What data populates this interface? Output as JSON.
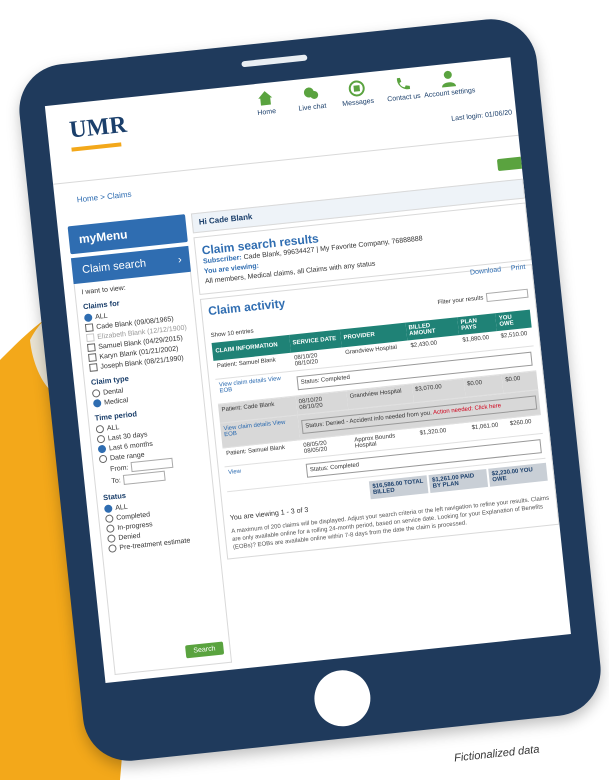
{
  "colors": {
    "brand_navy": "#1f3a5c",
    "hand_orange": "#f3a81a",
    "table_teal": "#1f8276",
    "action_green": "#5aa33f",
    "menu_blue": "#2f6db1"
  },
  "header": {
    "logo": "UMR",
    "nav": [
      {
        "label": "Home",
        "icon": "home-icon"
      },
      {
        "label": "Live chat",
        "icon": "chat-icon"
      },
      {
        "label": "Messages",
        "icon": "messages-icon"
      },
      {
        "label": "Contact us",
        "icon": "phone-icon"
      },
      {
        "label": "Account settings",
        "icon": "person-icon"
      }
    ],
    "last_login": "Last login: 01/06/20"
  },
  "breadcrumb": "Home > Claims",
  "sidebar": {
    "mymenu": "myMenu",
    "claim_search": "Claim search",
    "intro": "I want to view:",
    "claims_for": {
      "heading": "Claims for",
      "options": [
        "ALL",
        "Cade Blank (09/08/1965)",
        "Elizabeth Blank (12/12/1900)",
        "Samuel Blank (04/29/2015)",
        "Karyn Blank (01/21/2002)",
        "Joseph Blank (08/21/1990)"
      ]
    },
    "claim_type": {
      "heading": "Claim type",
      "options": [
        "Dental",
        "Medical"
      ]
    },
    "time_period": {
      "heading": "Time period",
      "options": [
        "ALL",
        "Last 30 days",
        "Last 6 months",
        "Date range"
      ],
      "from": "From:",
      "to": "To:"
    },
    "status": {
      "heading": "Status",
      "options": [
        "ALL",
        "Completed",
        "In-progress",
        "Denied",
        "Pre-treatment estimate"
      ]
    },
    "search_button": "Search"
  },
  "main": {
    "greeting": "Hi Cade Blank",
    "results": {
      "title": "Claim search results",
      "subscriber_label": "Subscriber:",
      "subscriber": "Cade Blank, 99634427 | My Favorite Company, 76888888",
      "viewing_label": "You are viewing:",
      "viewing": "All members, Medical claims, all Claims with any status"
    },
    "activity": {
      "title": "Claim activity",
      "download": "Download",
      "print": "Print",
      "filter": "Filter your results",
      "show": "Show 10 entries",
      "columns": [
        "CLAIM INFORMATION",
        "SERVICE DATE",
        "PROVIDER",
        "BILLED AMOUNT",
        "PLAN PAYS",
        "YOU OWE"
      ],
      "rows": [
        {
          "patient": "Patient: Samuel Blank",
          "date": "08/10/20 08/10/20",
          "provider": "Grandview Hospital",
          "billed": "$2,430.00",
          "plan": "$1,880.00",
          "owe": "$2,510.00",
          "status": "Status: Completed",
          "links": "View claim details View EOB"
        },
        {
          "patient": "Patient: Cade Blank",
          "date": "08/10/20 08/10/20",
          "provider": "Grandview Hospital",
          "billed": "$3,070.00",
          "plan": "$0.00",
          "owe": "$0.00",
          "status": "Status: Denied - Accident info needed from you.",
          "alert": "Action needed: Click here",
          "links": "View claim details View EOB",
          "denied": true
        },
        {
          "patient": "Patient: Samuel Blank",
          "date": "08/05/20 08/05/20",
          "provider": "Approx Bounds Hospital",
          "billed": "$1,320.00",
          "plan": "$1,061.00",
          "owe": "$260.00",
          "status": "Status: Completed",
          "links": "View"
        }
      ],
      "totals": [
        "$16,586.00 TOTAL BILLED",
        "$1,261.00 PAID BY PLAN",
        "$2,230.00 YOU OWE"
      ],
      "showing": "You are viewing 1 - 3 of 3",
      "footnote": "A maximum of 200 claims will be displayed. Adjust your search criteria or the left navigation to refine your results. Claims are only available online for a rolling 24-month period, based on service date. Looking for your Explanation of Benefits (EOBs)? EOBs are available online within 7-8 days from the date the claim is processed."
    }
  },
  "fictional_note": "Fictionalized data"
}
